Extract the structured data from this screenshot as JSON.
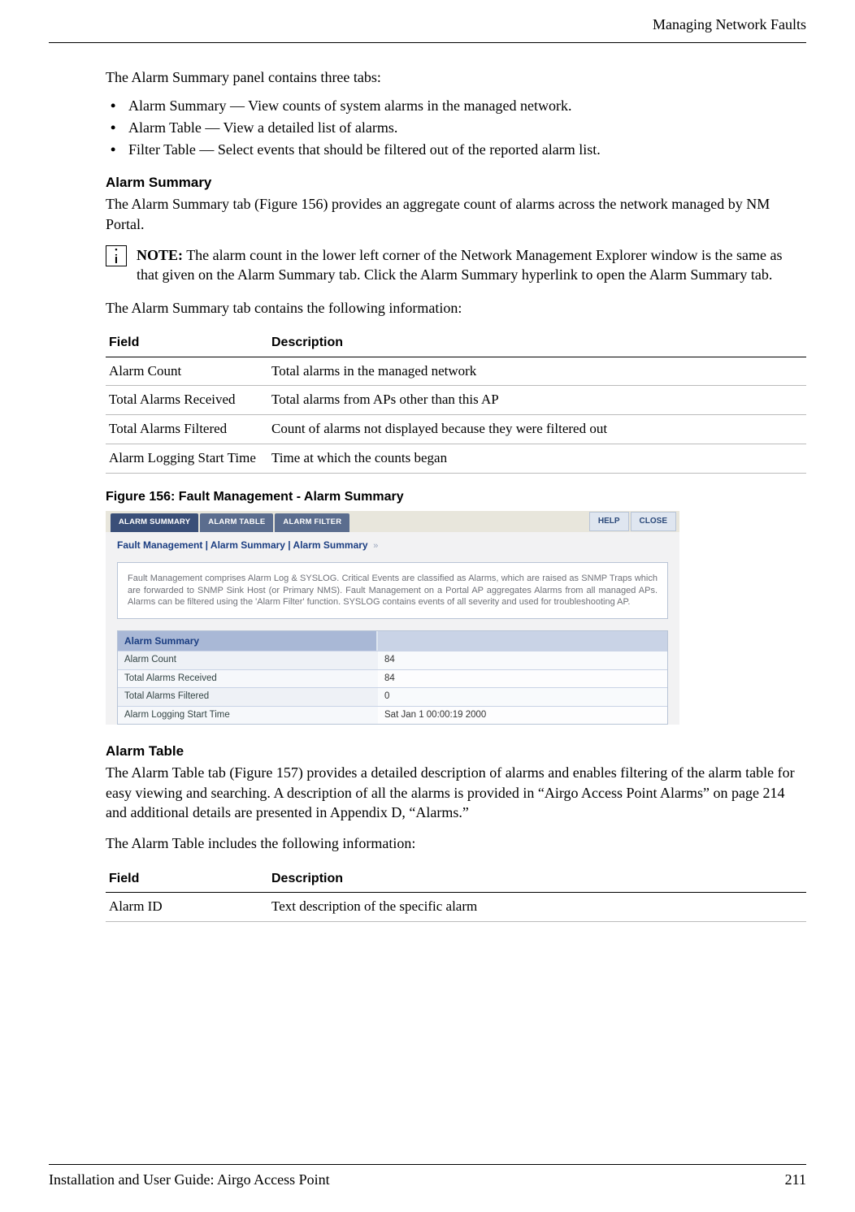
{
  "header_title": "Managing Network Faults",
  "intro": "The Alarm Summary panel contains three tabs:",
  "bullets": [
    "Alarm Summary — View counts of system alarms in the managed network.",
    "Alarm Table — View a detailed list of alarms.",
    "Filter Table — Select events that should be filtered out of the reported alarm list."
  ],
  "sec1": {
    "heading": "Alarm Summary",
    "para1": "The Alarm Summary tab (Figure 156) provides an aggregate count of alarms across the network managed by NM Portal.",
    "note_label": "NOTE:",
    "note_text": " The alarm count in the lower left corner of the Network Management Explorer window is the same as that given on the Alarm Summary tab. Click the Alarm Summary hyperlink to open the Alarm Summary tab.",
    "para2": "The Alarm Summary tab contains the following information:",
    "table_headers": {
      "c1": "Field",
      "c2": "Description"
    },
    "rows": [
      {
        "f": "Alarm Count",
        "d": "Total alarms in the managed network"
      },
      {
        "f": "Total Alarms Received",
        "d": "Total alarms from APs other than this AP"
      },
      {
        "f": "Total Alarms Filtered",
        "d": "Count of alarms not displayed because they were filtered out"
      },
      {
        "f": "Alarm Logging Start Time",
        "d": "Time at which the counts began"
      }
    ],
    "fig_caption": "Figure 156:    Fault Management - Alarm Summary"
  },
  "shot": {
    "tabs": [
      "ALARM SUMMARY",
      "ALARM TABLE",
      "ALARM FILTER"
    ],
    "help": "HELP",
    "close": "CLOSE",
    "crumb": "Fault Management | Alarm Summary | Alarm Summary",
    "crumb_arrows": "»",
    "desc": "Fault Management comprises Alarm Log & SYSLOG. Critical Events are classified as Alarms, which are raised as SNMP Traps which are forwarded to SNMP Sink Host (or Primary NMS). Fault Management on a Portal AP aggregates Alarms from all managed APs. Alarms can be filtered using the 'Alarm Filter' function. SYSLOG contains events of all severity and used for troubleshooting AP.",
    "panel_title": "Alarm Summary",
    "rows": [
      {
        "l": "Alarm Count",
        "v": "84"
      },
      {
        "l": "Total Alarms Received",
        "v": "84"
      },
      {
        "l": "Total Alarms Filtered",
        "v": "0"
      },
      {
        "l": "Alarm Logging Start Time",
        "v": "Sat Jan 1 00:00:19 2000"
      }
    ]
  },
  "sec2": {
    "heading": "Alarm Table",
    "para1": "The Alarm Table tab (Figure 157) provides a detailed description of alarms and enables filtering of the alarm table for easy viewing and searching. A description of all the alarms is provided in “Airgo Access Point Alarms” on page 214 and additional details are presented in Appendix D,  “Alarms.”",
    "para2": "The Alarm Table includes the following information:",
    "table_headers": {
      "c1": "Field",
      "c2": "Description"
    },
    "rows": [
      {
        "f": "Alarm ID",
        "d": "Text description of the specific alarm"
      }
    ]
  },
  "footer": {
    "left": "Installation and User Guide: Airgo Access Point",
    "right": "211"
  }
}
